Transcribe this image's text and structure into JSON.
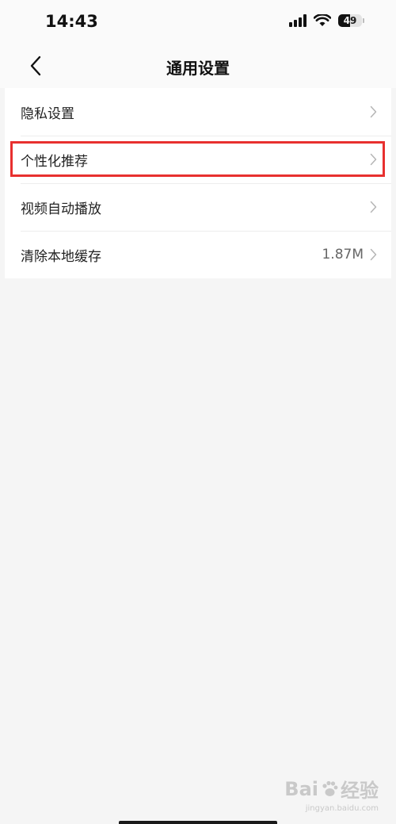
{
  "status_bar": {
    "time": "14:43",
    "battery_level": "49"
  },
  "nav": {
    "title": "通用设置"
  },
  "settings": {
    "items": [
      {
        "label": "隐私设置",
        "value": ""
      },
      {
        "label": "个性化推荐",
        "value": ""
      },
      {
        "label": "视频自动播放",
        "value": ""
      },
      {
        "label": "清除本地缓存",
        "value": "1.87M"
      }
    ]
  },
  "highlight_color": "#e8302f",
  "watermark": {
    "main_a": "Bai",
    "main_b": "经验",
    "sub": "jingyan.baidu.com"
  }
}
